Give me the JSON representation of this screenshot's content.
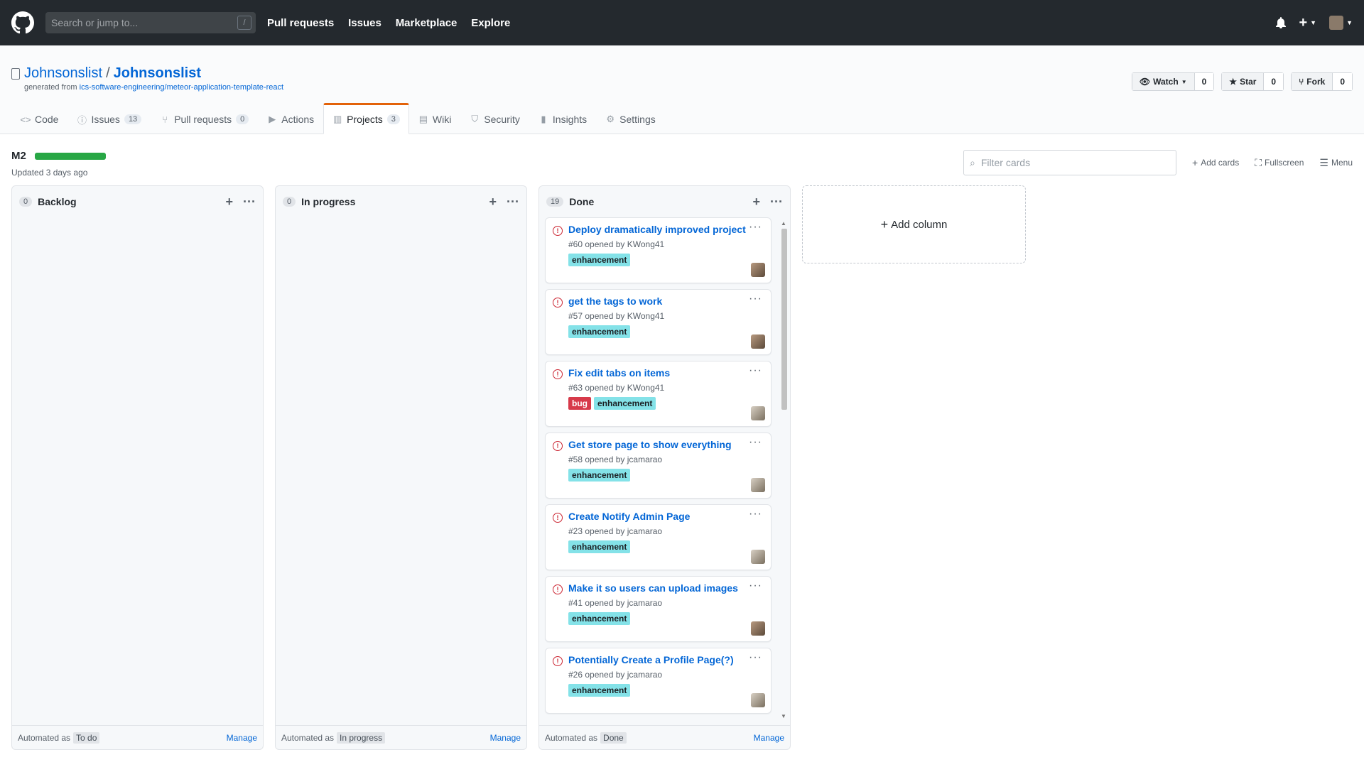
{
  "header": {
    "search_placeholder": "Search or jump to...",
    "search_shortcut": "/",
    "nav": [
      "Pull requests",
      "Issues",
      "Marketplace",
      "Explore"
    ]
  },
  "repo": {
    "owner": "Johnsonslist",
    "separator": "/",
    "name": "Johnsonslist",
    "generated_prefix": "generated from",
    "generated_from": "ics-software-engineering/meteor-application-template-react",
    "watch_label": "Watch",
    "watch_count": "0",
    "star_label": "Star",
    "star_count": "0",
    "fork_label": "Fork",
    "fork_count": "0"
  },
  "tabs": [
    {
      "label": "Code",
      "count": ""
    },
    {
      "label": "Issues",
      "count": "13"
    },
    {
      "label": "Pull requests",
      "count": "0"
    },
    {
      "label": "Actions",
      "count": ""
    },
    {
      "label": "Projects",
      "count": "3"
    },
    {
      "label": "Wiki",
      "count": ""
    },
    {
      "label": "Security",
      "count": ""
    },
    {
      "label": "Insights",
      "count": ""
    },
    {
      "label": "Settings",
      "count": ""
    }
  ],
  "project": {
    "name": "M2",
    "progress_percent": 100,
    "updated": "Updated 3 days ago",
    "filter_placeholder": "Filter cards",
    "add_cards": "Add cards",
    "fullscreen": "Fullscreen",
    "menu": "Menu",
    "add_column": "Add column"
  },
  "columns": [
    {
      "name": "Backlog",
      "count": "0",
      "automated_label": "Automated as",
      "automated_value": "To do",
      "manage": "Manage"
    },
    {
      "name": "In progress",
      "count": "0",
      "automated_label": "Automated as",
      "automated_value": "In progress",
      "manage": "Manage"
    },
    {
      "name": "Done",
      "count": "19",
      "automated_label": "Automated as",
      "automated_value": "Done",
      "manage": "Manage"
    }
  ],
  "done_cards": [
    {
      "title": "Deploy dramatically improved project",
      "meta": "#60 opened by KWong41",
      "labels": [
        "enhancement"
      ]
    },
    {
      "title": "get the tags to work",
      "meta": "#57 opened by KWong41",
      "labels": [
        "enhancement"
      ]
    },
    {
      "title": "Fix edit tabs on items",
      "meta": "#63 opened by KWong41",
      "labels": [
        "bug",
        "enhancement"
      ]
    },
    {
      "title": "Get store page to show everything",
      "meta": "#58 opened by jcamarao",
      "labels": [
        "enhancement"
      ]
    },
    {
      "title": "Create Notify Admin Page",
      "meta": "#23 opened by jcamarao",
      "labels": [
        "enhancement"
      ]
    },
    {
      "title": "Make it so users can upload images",
      "meta": "#41 opened by jcamarao",
      "labels": [
        "enhancement"
      ]
    },
    {
      "title": "Potentially Create a Profile Page(?)",
      "meta": "#26 opened by jcamarao",
      "labels": [
        "enhancement"
      ]
    }
  ],
  "colors": {
    "header_bg": "#24292e",
    "link": "#0366d6",
    "progress": "#28a745",
    "enhancement": "#84e2e8",
    "bug": "#d73a4a",
    "tab_accent": "#e36209"
  }
}
